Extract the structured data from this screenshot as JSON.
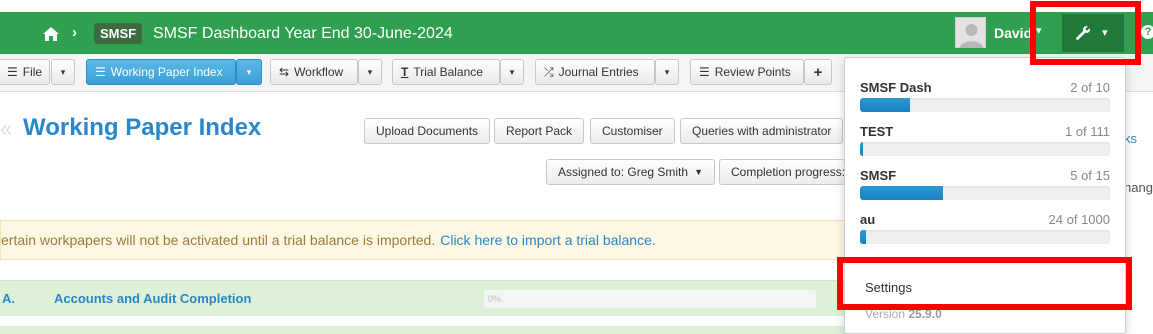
{
  "navbar": {
    "badge": "SMSF",
    "title": "SMSF Dashboard  Year End 30-June-2024",
    "user_name": "David",
    "user_caret": "▾",
    "tools_caret": "▾",
    "help": "?"
  },
  "toolbar": {
    "file_label": "File",
    "working_paper_index_label": "Working Paper Index",
    "workflow_label": "Workflow",
    "trial_balance_label": "Trial Balance",
    "journal_entries_label": "Journal Entries",
    "review_points_label": "Review Points",
    "add_label": "+",
    "caret": "▾"
  },
  "main": {
    "title": "Working Paper Index",
    "actions": [
      "Upload Documents",
      "Report Pack",
      "Customiser",
      "Queries with administrator"
    ],
    "assigned_label": "Assigned to: Greg Smith",
    "completion_label": "Completion progress:",
    "right_link": "ks",
    "right_text": "hang"
  },
  "alert": {
    "text": "ertain workpapers will not be activated until a trial balance is imported.",
    "link": "Click here to import a trial balance."
  },
  "section": {
    "number": "A.",
    "label": "Accounts and Audit Completion",
    "progress_text": "0%"
  },
  "dropdown": {
    "items": [
      {
        "name": "SMSF Dash",
        "count": "2 of 10",
        "fraction": 0.2
      },
      {
        "name": "TEST",
        "count": "1 of 111",
        "fraction": 0.009
      },
      {
        "name": "SMSF",
        "count": "5 of 15",
        "fraction": 0.333
      },
      {
        "name": "au",
        "count": "24 of 1000",
        "fraction": 0.024
      }
    ],
    "settings_label": "Settings",
    "version_label": "Version",
    "version_number": "25.9.0"
  },
  "colors": {
    "navbar_green": "#2ea04f",
    "tools_green": "#217a3a",
    "accent_blue": "#2a87c9",
    "highlight_red": "#ff0000"
  }
}
